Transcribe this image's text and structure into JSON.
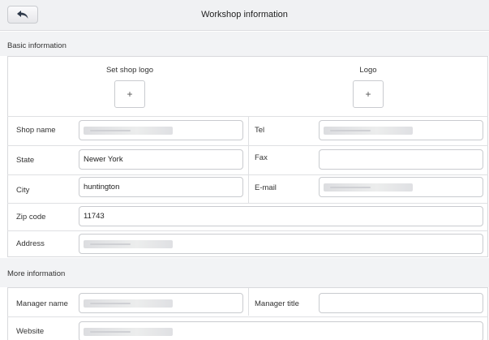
{
  "header": {
    "title": "Workshop information",
    "back_icon": "back-arrow-icon"
  },
  "basic": {
    "title": "Basic information",
    "shop_logo_label": "Set shop logo",
    "logo_label": "Logo",
    "add_symbol": "+",
    "shop_name_label": "Shop name",
    "tel_label": "Tel",
    "state_label": "State",
    "state_value": "Newer York",
    "fax_label": "Fax",
    "fax_value": "",
    "city_label": "City",
    "city_value": "huntington",
    "email_label": "E-mail",
    "zip_label": "Zip code",
    "zip_value": "11743",
    "address_label": "Address"
  },
  "more": {
    "title": "More information",
    "manager_name_label": "Manager name",
    "manager_title_label": "Manager title",
    "manager_title_value": "",
    "website_label": "Website"
  }
}
